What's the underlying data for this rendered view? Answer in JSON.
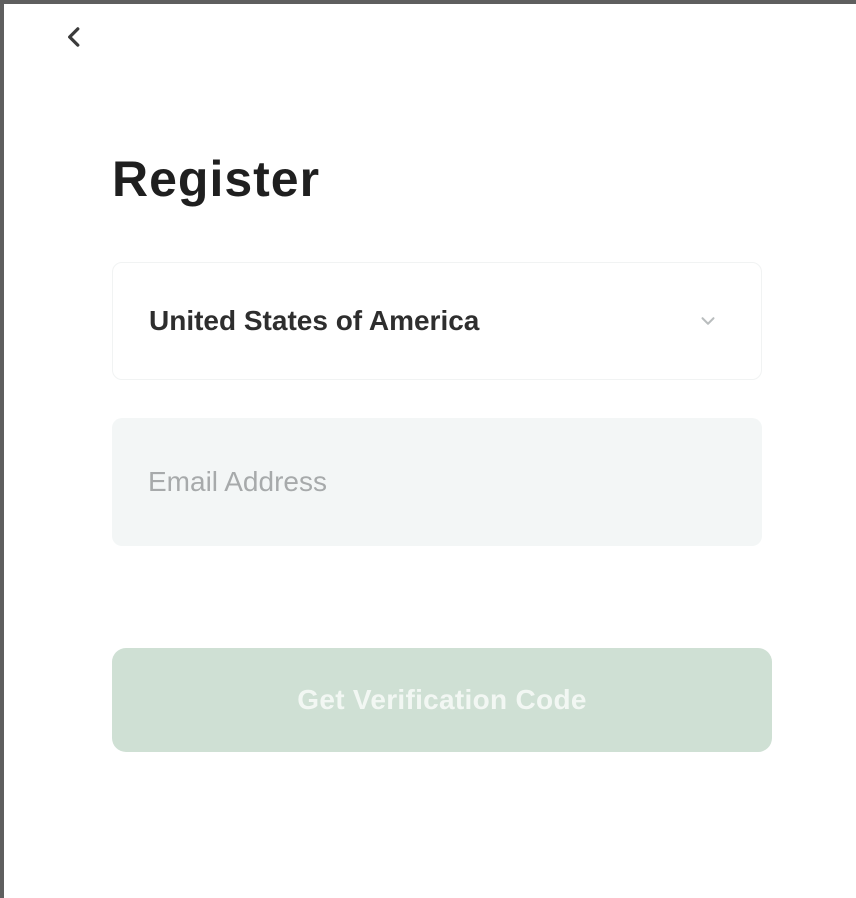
{
  "header": {
    "back_icon": "chevron-left-icon"
  },
  "page": {
    "title": "Register"
  },
  "form": {
    "country": {
      "selected_value": "United States of America",
      "icon": "chevron-down-icon"
    },
    "email": {
      "placeholder": "Email Address",
      "value": ""
    },
    "primary_button": {
      "label": "Get Verification Code"
    }
  },
  "colors": {
    "primary_button_disabled_bg": "#cfe0d4",
    "email_field_bg": "#f3f6f6",
    "text_dark": "#1f1f1f",
    "placeholder": "#a7aaab"
  }
}
